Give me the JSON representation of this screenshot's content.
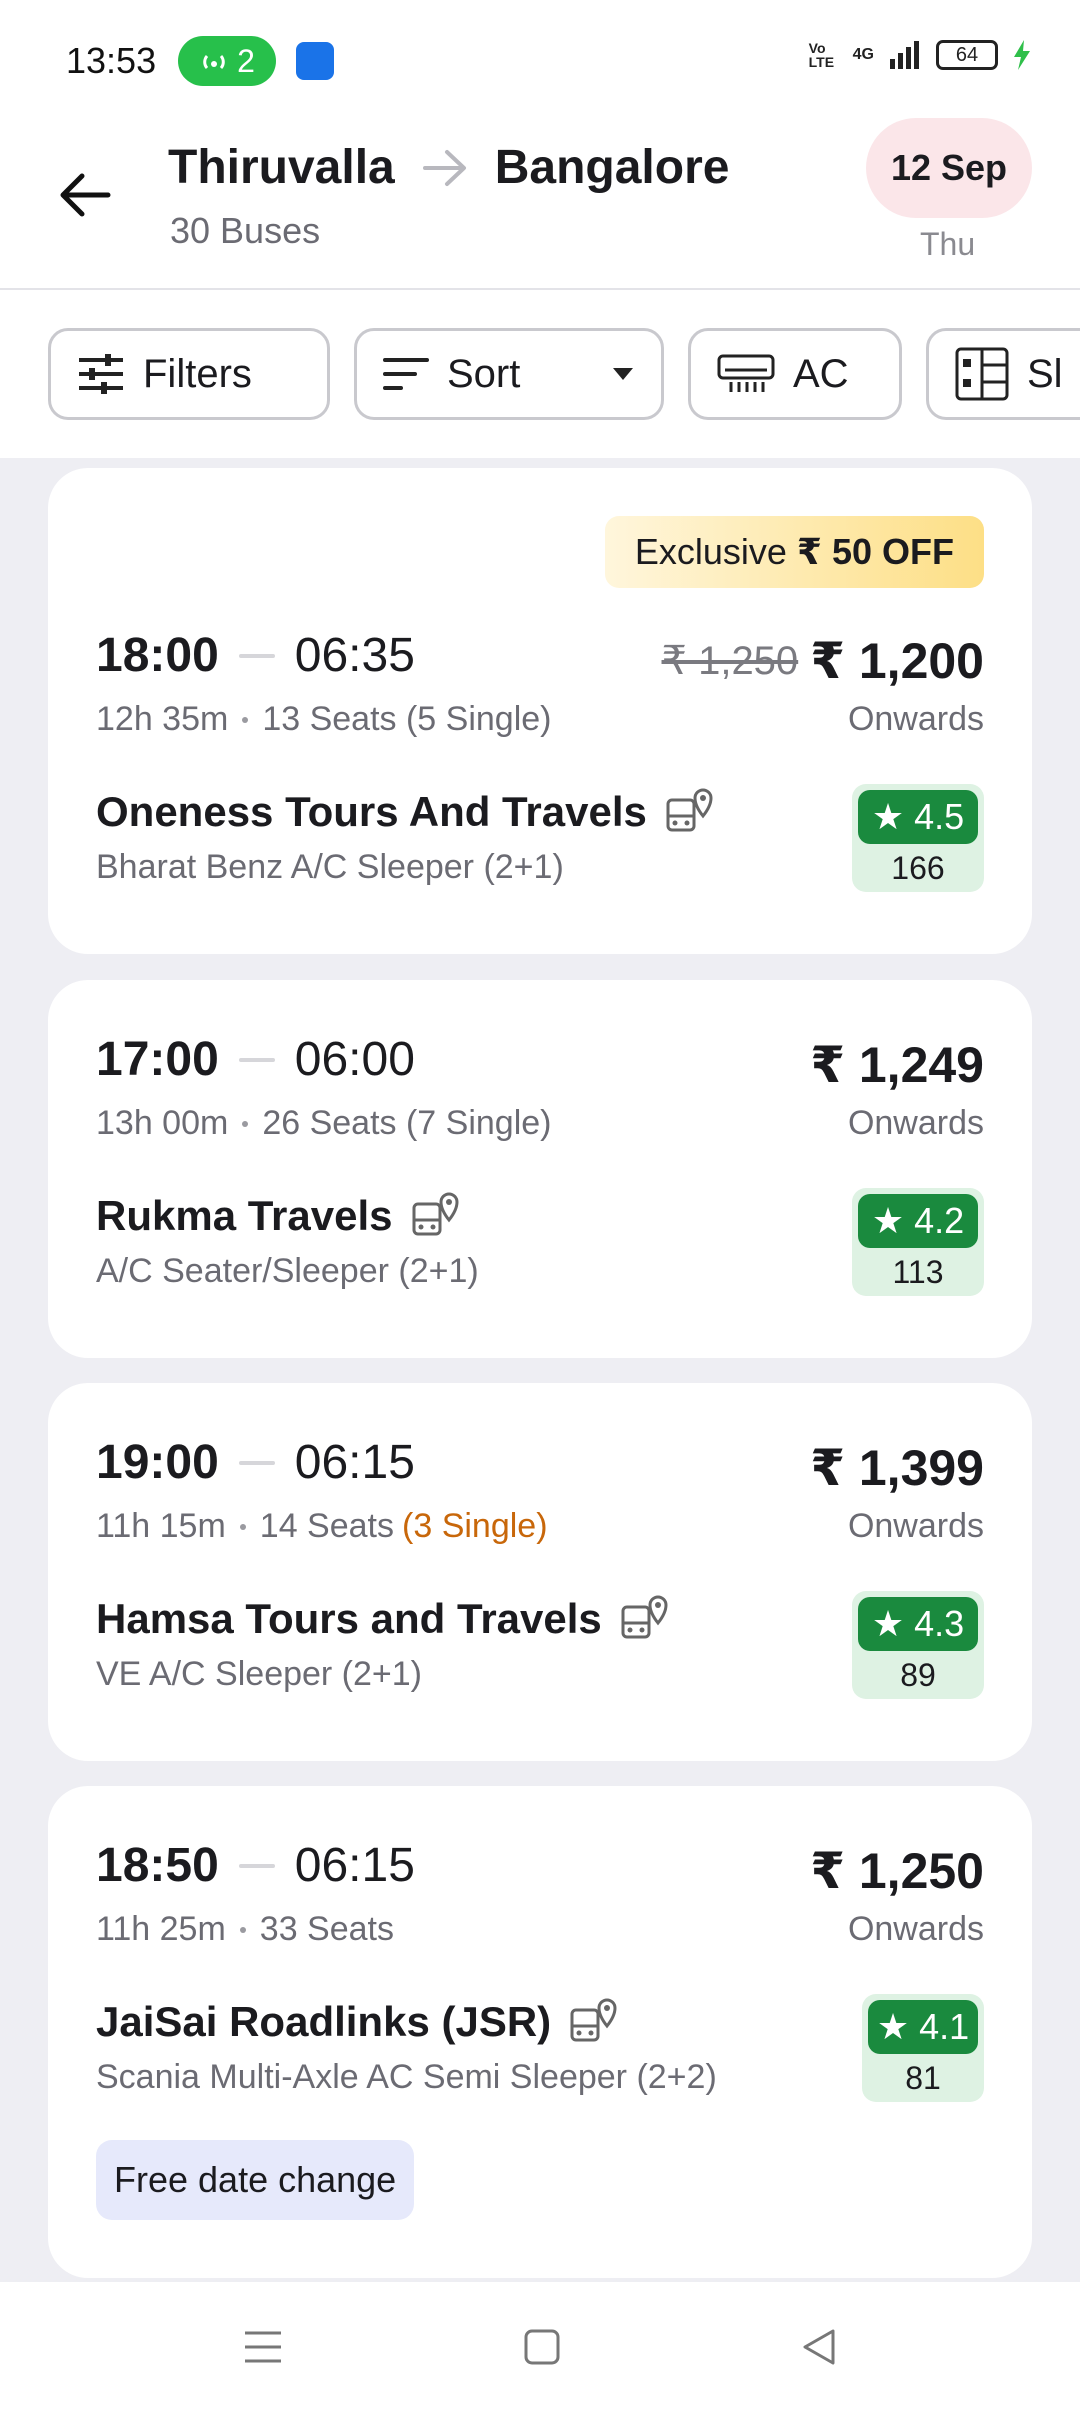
{
  "status_bar": {
    "time": "13:53",
    "hotspot_count": "2",
    "network_label": "4G",
    "volte_label": "Vo LTE",
    "battery": "64"
  },
  "header": {
    "from_city": "Thiruvalla",
    "to_city": "Bangalore",
    "bus_count": "30 Buses",
    "date": "12 Sep",
    "day": "Thu"
  },
  "filters": {
    "filters_label": "Filters",
    "sort_label": "Sort",
    "ac_label": "AC",
    "sleeper_label": "Sl"
  },
  "buses": [
    {
      "offer": "Exclusive",
      "offer_amount": "₹ 50 OFF",
      "departure": "18:00",
      "arrival": "06:35",
      "duration": "12h 35m",
      "seats": "13 Seats (5 Single)",
      "original_price": "₹ 1,250",
      "price": "₹ 1,200",
      "price_note": "Onwards",
      "operator": "Oneness Tours And Travels",
      "bus_type": "Bharat Benz A/C Sleeper (2+1)",
      "rating": "4.5",
      "rating_count": "166"
    },
    {
      "departure": "17:00",
      "arrival": "06:00",
      "duration": "13h 00m",
      "seats": "26 Seats (7 Single)",
      "price": "₹  1,249",
      "price_note": "Onwards",
      "operator": "Rukma Travels",
      "bus_type": "A/C Seater/Sleeper (2+1)",
      "rating": "4.2",
      "rating_count": "113"
    },
    {
      "departure": "19:00",
      "arrival": "06:15",
      "duration": "11h 15m",
      "seats": "14 Seats",
      "seats_single": "(3 Single)",
      "price": "₹  1,399",
      "price_note": "Onwards",
      "operator": "Hamsa Tours and Travels",
      "bus_type": "VE A/C Sleeper (2+1)",
      "rating": "4.3",
      "rating_count": "89"
    },
    {
      "departure": "18:50",
      "arrival": "06:15",
      "duration": "11h 25m",
      "seats": "33 Seats",
      "price": "₹  1,250",
      "price_note": "Onwards",
      "operator": "JaiSai Roadlinks (JSR)",
      "bus_type": "Scania Multi-Axle AC Semi Sleeper (2+2)",
      "rating": "4.1",
      "rating_count": "81",
      "tag": "Free date change"
    }
  ],
  "icons": {
    "back": "arrow-left-icon",
    "route": "arrow-right-icon",
    "filters": "sliders-icon",
    "sort": "sort-icon",
    "ac": "ac-icon",
    "sleeper": "seat-layout-icon",
    "tracking": "bus-location-icon",
    "star": "star-icon"
  },
  "colors": {
    "rating_green": "#1a8a3e",
    "date_pill": "#fbe6e9",
    "offer_gold": "#fddf86",
    "single_orange": "#c8670a"
  }
}
